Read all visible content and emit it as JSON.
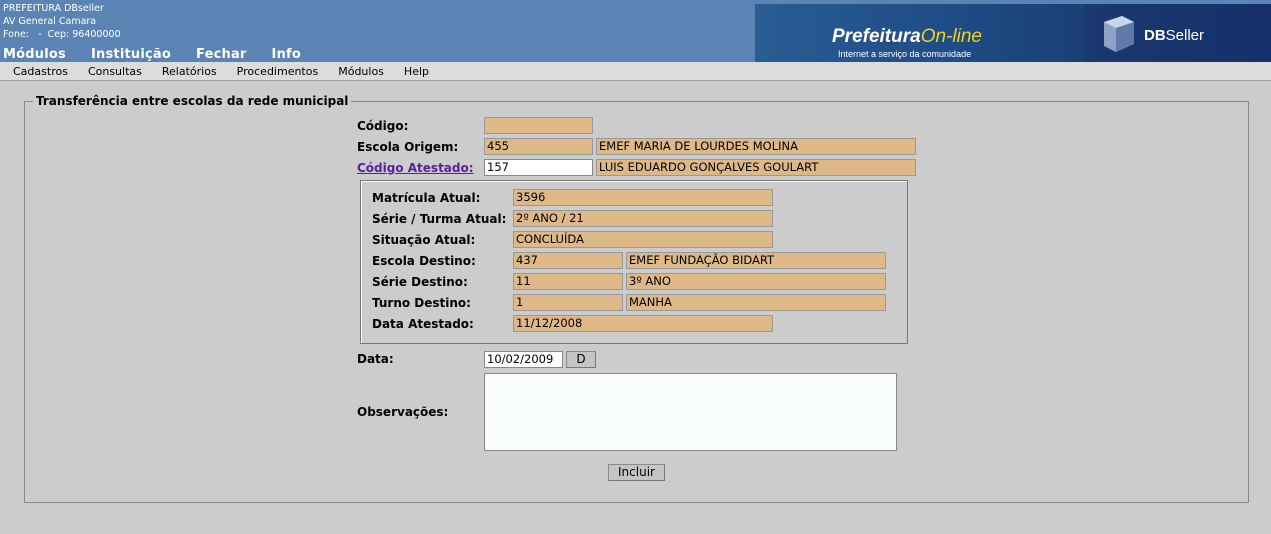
{
  "header": {
    "org_name": "PREFEITURA DBseller",
    "address": "AV General Camara",
    "phone_line": "Fone:   -  Cep: 96400000",
    "top_menu": [
      "Módulos",
      "Instituição",
      "Fechar",
      "Info"
    ],
    "banner": {
      "brand_main": "Prefeitura",
      "brand_accent": "On-line",
      "tagline": "Internet a serviço da comunidade",
      "vendor_prefix": "DB",
      "vendor_suffix": "Seller"
    }
  },
  "menubar": [
    "Cadastros",
    "Consultas",
    "Relatórios",
    "Procedimentos",
    "Módulos",
    "Help"
  ],
  "form": {
    "legend": "Transferência entre escolas da rede municipal",
    "codigo": {
      "label": "Código:",
      "value": ""
    },
    "escola_origem": {
      "label": "Escola Origem:",
      "code": "455",
      "name": "EMEF MARIA DE LOURDES MOLINA"
    },
    "codigo_atestado": {
      "label": "Código Atestado:",
      "code": "157",
      "name": "LUIS EDUARDO GONÇALVES GOULART"
    },
    "details": {
      "matricula_atual": {
        "label": "Matrícula Atual:",
        "value": "3596"
      },
      "serie_turma_atual": {
        "label": "Série / Turma Atual:",
        "value": "2º ANO / 21"
      },
      "situacao_atual": {
        "label": "Situação Atual:",
        "value": "CONCLUÍDA"
      },
      "escola_destino": {
        "label": "Escola Destino:",
        "code": "437",
        "name": "EMEF FUNDAÇÃO BIDART"
      },
      "serie_destino": {
        "label": "Série Destino:",
        "code": "11",
        "name": "3º ANO"
      },
      "turno_destino": {
        "label": "Turno Destino:",
        "code": "1",
        "name": "MANHA"
      },
      "data_atestado": {
        "label": "Data Atestado:",
        "value": "11/12/2008"
      }
    },
    "data": {
      "label": "Data:",
      "value": "10/02/2009",
      "picker_label": "D"
    },
    "observacoes": {
      "label": "Observações:",
      "value": ""
    },
    "submit_label": "Incluir"
  },
  "colors": {
    "header_bg": "#5b84b4",
    "readonly_bg": "#deb887",
    "link": "#5a1f9e",
    "page_bg": "#cccccc"
  }
}
